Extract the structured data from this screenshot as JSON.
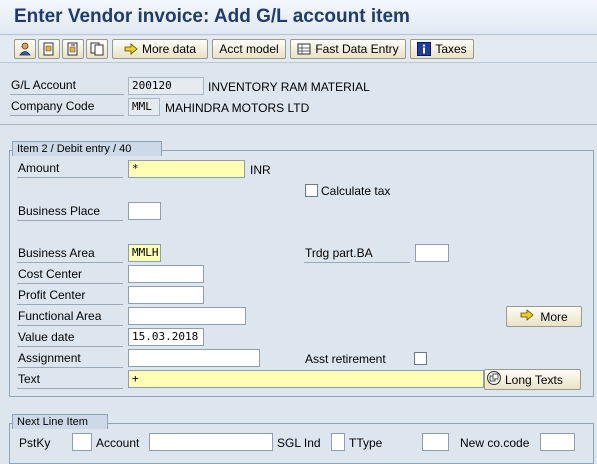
{
  "header": {
    "title": "Enter Vendor invoice: Add G/L account item"
  },
  "toolbar": {
    "more_data": "More data",
    "acct_model": "Acct model",
    "fast_data_entry": "Fast Data Entry",
    "taxes": "Taxes"
  },
  "header_fields": {
    "gl_account_label": "G/L Account",
    "gl_account_value": "200120",
    "gl_account_desc": "INVENTORY RAM MATERIAL",
    "company_code_label": "Company Code",
    "company_code_value": "MML",
    "company_code_desc": "MAHINDRA MOTORS LTD"
  },
  "item": {
    "group_title": "Item 2 / Debit entry / 40",
    "amount_label": "Amount",
    "amount_value": "*",
    "currency": "INR",
    "calculate_tax_label": "Calculate tax",
    "business_place_label": "Business Place",
    "business_area_label": "Business Area",
    "business_area_value": "MMLH",
    "trdg_part_label": "Trdg part.BA",
    "cost_center_label": "Cost Center",
    "profit_center_label": "Profit Center",
    "functional_area_label": "Functional Area",
    "value_date_label": "Value date",
    "value_date_value": "15.03.2018",
    "assignment_label": "Assignment",
    "asst_retirement_label": "Asst retirement",
    "text_label": "Text",
    "text_value": "+",
    "more_button": "More",
    "long_texts_button": "Long Texts"
  },
  "next_line": {
    "group_title": "Next Line Item",
    "pstky_label": "PstKy",
    "account_label": "Account",
    "sgl_ind_label": "SGL Ind",
    "ttype_label": "TType",
    "new_cocode_label": "New co.code"
  },
  "colors": {
    "title": "#1f3c6c",
    "background": "#dde6ef",
    "required_field": "#ffffb4"
  }
}
